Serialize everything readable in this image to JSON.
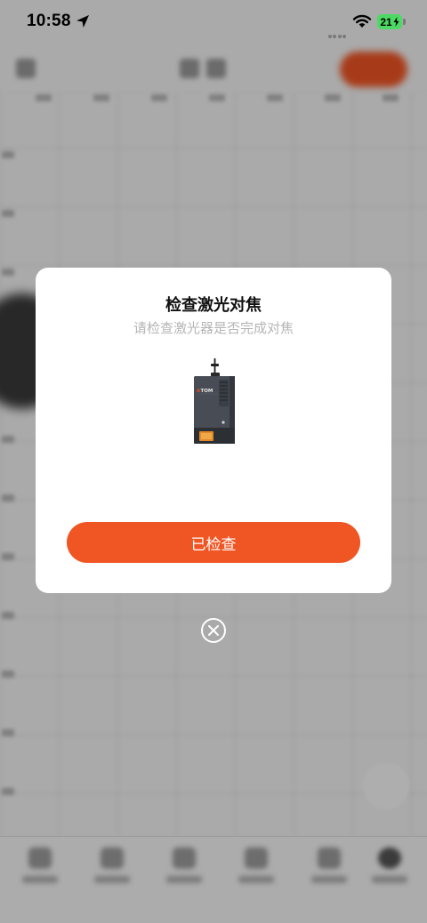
{
  "status_bar": {
    "time": "10:58",
    "battery_level": "21",
    "location_icon": "location-arrow-icon",
    "wifi_icon": "wifi-icon",
    "battery_color": "#4cd964"
  },
  "dialog": {
    "title": "检查激光对焦",
    "subtitle": "请检查激光器是否完成对焦",
    "image_icon": "laser-module-image",
    "image_brand": "ATOMSTACK",
    "confirm_label": "已检查",
    "close_icon": "close-circle-icon"
  },
  "colors": {
    "accent": "#f05524",
    "overlay": "rgba(0,0,0,0.30)",
    "subtitle": "#b5b5b5"
  }
}
